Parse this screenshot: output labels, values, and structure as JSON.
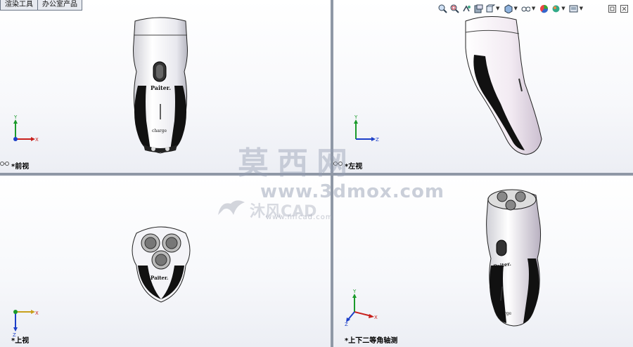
{
  "menu_tabs": [
    "渲染工具",
    "办公室产品"
  ],
  "toolbar_icons": [
    "zoom-to-fit-icon",
    "zoom-area-icon",
    "previous-view-icon",
    "section-view-icon",
    "view-orientation-icon",
    "display-style-icon",
    "hide-show-icon",
    "edit-appearance-icon",
    "apply-scene-icon",
    "view-settings-icon",
    "restore-window-icon",
    "close-window-icon"
  ],
  "viewports": {
    "front": {
      "label": "*前视",
      "triad": [
        "Y",
        "X"
      ]
    },
    "left": {
      "label": "*左视",
      "triad": [
        "Y",
        "Z"
      ]
    },
    "top": {
      "label": "*上视",
      "triad": [
        "X",
        "Z"
      ]
    },
    "iso": {
      "label": "*上下二等角轴测",
      "triad": [
        "Y",
        "X",
        "Z"
      ]
    }
  },
  "model": {
    "brand_text": "Paiter.",
    "button_text": "charge"
  },
  "watermarks": {
    "cn": "莫西网",
    "url": "www.3dmox.com",
    "mfcad": "沐风CAD",
    "mfcad_url": "www.mfcad.com"
  },
  "colors": {
    "border": "#8f98a6",
    "axis_x": "#c8201c",
    "axis_y": "#1a9a2a",
    "axis_z": "#1c3fc8"
  }
}
